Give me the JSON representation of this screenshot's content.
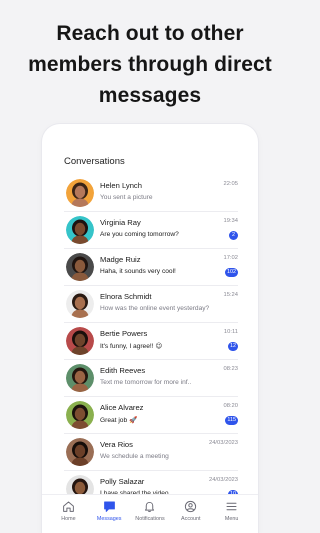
{
  "headline": {
    "line1": "Reach out to other",
    "line2": "members through direct",
    "line3": "messages"
  },
  "conversations_title": "Conversations",
  "accent_color": "#2f54eb",
  "conversations": [
    {
      "name": "Helen Lynch",
      "preview": "You sent a picture",
      "time": "22:05",
      "badge": "",
      "unread": false,
      "skin": "#b5785a",
      "hair": "#3a2416",
      "bg": "#f2a33a"
    },
    {
      "name": "Virginia Ray",
      "preview": "Are you coming tomorrow?",
      "time": "19:34",
      "badge": "2",
      "unread": true,
      "skin": "#7a4a2e",
      "hair": "#1d1210",
      "bg": "#35c4c9"
    },
    {
      "name": "Madge Ruiz",
      "preview": "Haha, it sounds very cool!",
      "time": "17:02",
      "badge": "102",
      "unread": true,
      "skin": "#8a5a3c",
      "hair": "#1f1410",
      "bg": "#4a4a4a"
    },
    {
      "name": "Elnora Schmidt",
      "preview": "How was the online event yesterday?",
      "time": "15:24",
      "badge": "",
      "unread": false,
      "skin": "#a8704f",
      "hair": "#2a1a12",
      "bg": "#ededed"
    },
    {
      "name": "Bertie Powers",
      "preview": "It's funny, I agree!! 😉",
      "time": "10:11",
      "badge": "12",
      "unread": true,
      "skin": "#6e432b",
      "hair": "#1a0f0b",
      "bg": "#b84a4a"
    },
    {
      "name": "Edith Reeves",
      "preview": "Text me tomorrow for more inf..",
      "time": "08:23",
      "badge": "",
      "unread": false,
      "skin": "#9a6444",
      "hair": "#24160f",
      "bg": "#5d8f6a"
    },
    {
      "name": "Alice Alvarez",
      "preview": "Great job 🚀",
      "time": "08:20",
      "badge": "115",
      "unread": true,
      "skin": "#7d4d31",
      "hair": "#1b110c",
      "bg": "#8ab04e"
    },
    {
      "name": "Vera Rios",
      "preview": "We schedule a meeting",
      "time": "24/03/2023",
      "badge": "",
      "unread": false,
      "skin": "#6b3f28",
      "hair": "#150d09",
      "bg": "#9a6e55"
    },
    {
      "name": "Polly Salazar",
      "preview": "I have shared the video",
      "time": "24/03/2023",
      "badge": "10",
      "unread": true,
      "skin": "#8b5a3a",
      "hair": "#241510",
      "bg": "#e4e4e4"
    }
  ],
  "tabs": [
    {
      "label": "Home",
      "icon": "home-icon",
      "active": false
    },
    {
      "label": "Messages",
      "icon": "messages-icon",
      "active": true
    },
    {
      "label": "Notifications",
      "icon": "bell-icon",
      "active": false
    },
    {
      "label": "Account",
      "icon": "account-icon",
      "active": false
    },
    {
      "label": "Menu",
      "icon": "menu-icon",
      "active": false
    }
  ]
}
